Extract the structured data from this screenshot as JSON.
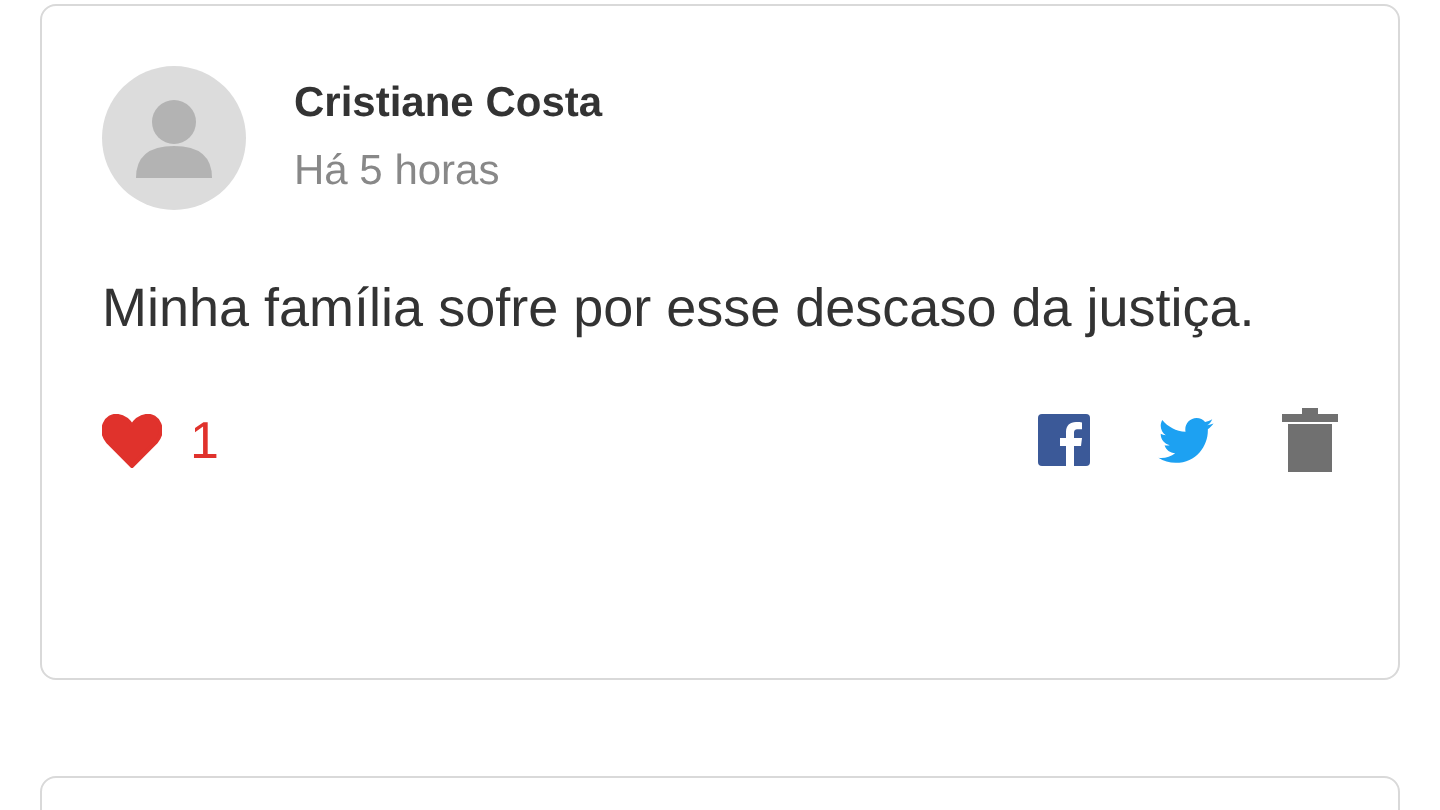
{
  "comments": [
    {
      "author": "Cristiane Costa",
      "time": "Há 5 horas",
      "text": "Minha família sofre por esse descaso da justiça.",
      "liked": true,
      "likes": "1"
    }
  ]
}
